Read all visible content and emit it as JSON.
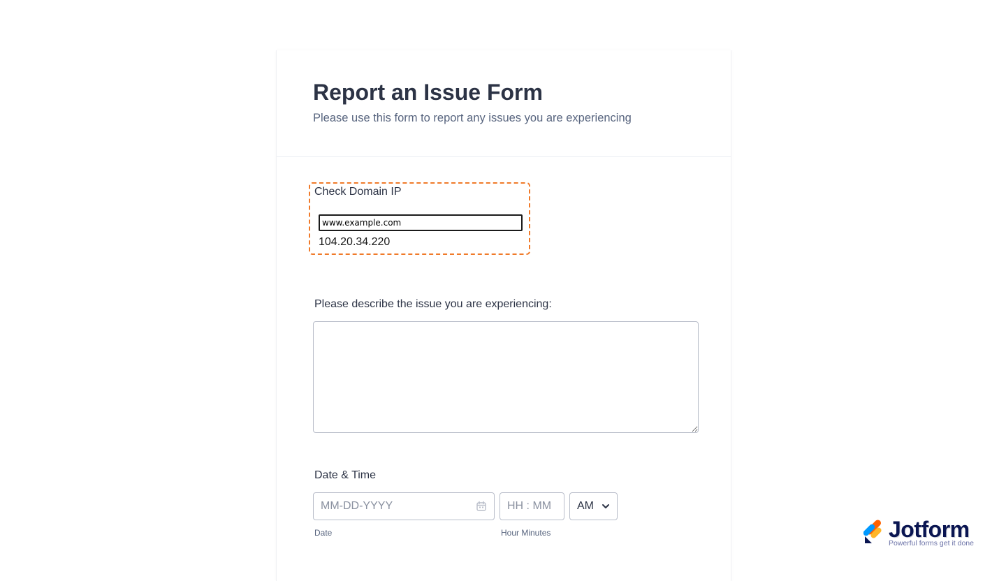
{
  "form": {
    "title": "Report an Issue Form",
    "subtitle": "Please use this form to report any issues you are experiencing"
  },
  "domain_check": {
    "label": "Check Domain IP",
    "input_value": "www.example.com",
    "result": "104.20.34.220",
    "border_color": "#f07a29"
  },
  "issue": {
    "label": "Please describe the issue you are experiencing:",
    "value": ""
  },
  "datetime": {
    "label": "Date & Time",
    "date_placeholder": "MM-DD-YYYY",
    "date_sublabel": "Date",
    "time_placeholder": "HH : MM",
    "time_sublabel": "Hour Minutes",
    "ampm_value": "AM",
    "date_icon": "calendar-icon",
    "ampm_icon": "chevron-down-icon"
  },
  "brand": {
    "name": "Jotform",
    "tagline": "Powerful forms get it done",
    "icon": "jotform-logo-icon"
  }
}
